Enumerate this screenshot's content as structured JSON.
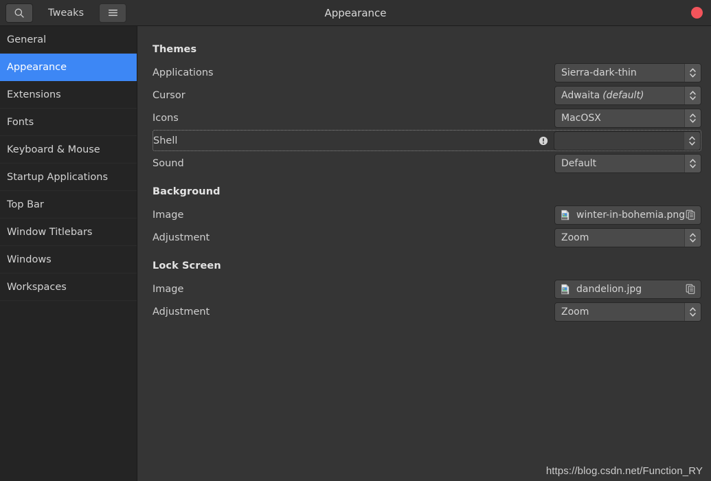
{
  "header": {
    "app_name": "Tweaks",
    "title": "Appearance",
    "search_icon": "search-icon",
    "menu_icon": "hamburger-menu-icon",
    "close_icon": "close-button-red"
  },
  "sidebar": {
    "items": [
      {
        "label": "General",
        "selected": false
      },
      {
        "label": "Appearance",
        "selected": true
      },
      {
        "label": "Extensions",
        "selected": false
      },
      {
        "label": "Fonts",
        "selected": false
      },
      {
        "label": "Keyboard & Mouse",
        "selected": false
      },
      {
        "label": "Startup Applications",
        "selected": false
      },
      {
        "label": "Top Bar",
        "selected": false
      },
      {
        "label": "Window Titlebars",
        "selected": false
      },
      {
        "label": "Windows",
        "selected": false
      },
      {
        "label": "Workspaces",
        "selected": false
      }
    ]
  },
  "sections": {
    "themes": {
      "title": "Themes",
      "rows": {
        "applications": {
          "label": "Applications",
          "value": "Sierra-dark-thin"
        },
        "cursor": {
          "label": "Cursor",
          "value": "Adwaita",
          "value_italic": "(default)"
        },
        "icons": {
          "label": "Icons",
          "value": "MacOSX"
        },
        "shell": {
          "label": "Shell",
          "value": ""
        },
        "sound": {
          "label": "Sound",
          "value": "Default"
        }
      }
    },
    "background": {
      "title": "Background",
      "rows": {
        "image": {
          "label": "Image",
          "value": "winter-in-bohemia.png"
        },
        "adjustment": {
          "label": "Adjustment",
          "value": "Zoom"
        }
      }
    },
    "lock_screen": {
      "title": "Lock Screen",
      "rows": {
        "image": {
          "label": "Image",
          "value": "dandelion.jpg"
        },
        "adjustment": {
          "label": "Adjustment",
          "value": "Zoom"
        }
      }
    }
  },
  "watermark": "https://blog.csdn.net/Function_RY",
  "colors": {
    "selection": "#3d87f5",
    "sidebar_bg": "#242424",
    "content_bg": "#353535",
    "header_bg": "#303030",
    "close_red": "#f2545b"
  }
}
